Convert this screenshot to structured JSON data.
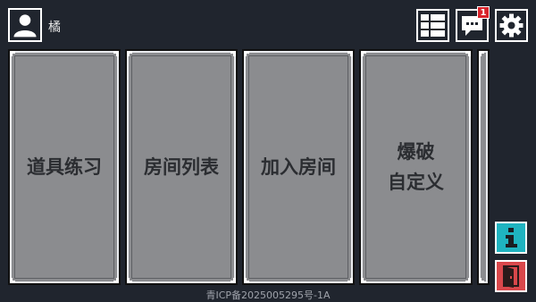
{
  "user": {
    "name": "橘",
    "avatar_icon": "user-avatar-icon"
  },
  "toolbar": {
    "buttons": [
      {
        "icon": "grid-menu-icon"
      },
      {
        "icon": "chat-icon",
        "badge": "1"
      },
      {
        "icon": "gear-icon"
      }
    ]
  },
  "cards": [
    {
      "lines": [
        "道具练习"
      ]
    },
    {
      "lines": [
        "房间列表"
      ]
    },
    {
      "lines": [
        "加入房间"
      ]
    },
    {
      "lines": [
        "爆破",
        "自定义"
      ]
    }
  ],
  "side_buttons": [
    {
      "icon": "info-icon",
      "color": "#1fb3c0"
    },
    {
      "icon": "exit-door-icon",
      "color": "#d9474b"
    }
  ],
  "colors": {
    "background": "#20252e",
    "card": "#8b8c8f",
    "badge": "#d8232a"
  },
  "footer": {
    "icp": "青ICP备2025005295号-1A"
  }
}
